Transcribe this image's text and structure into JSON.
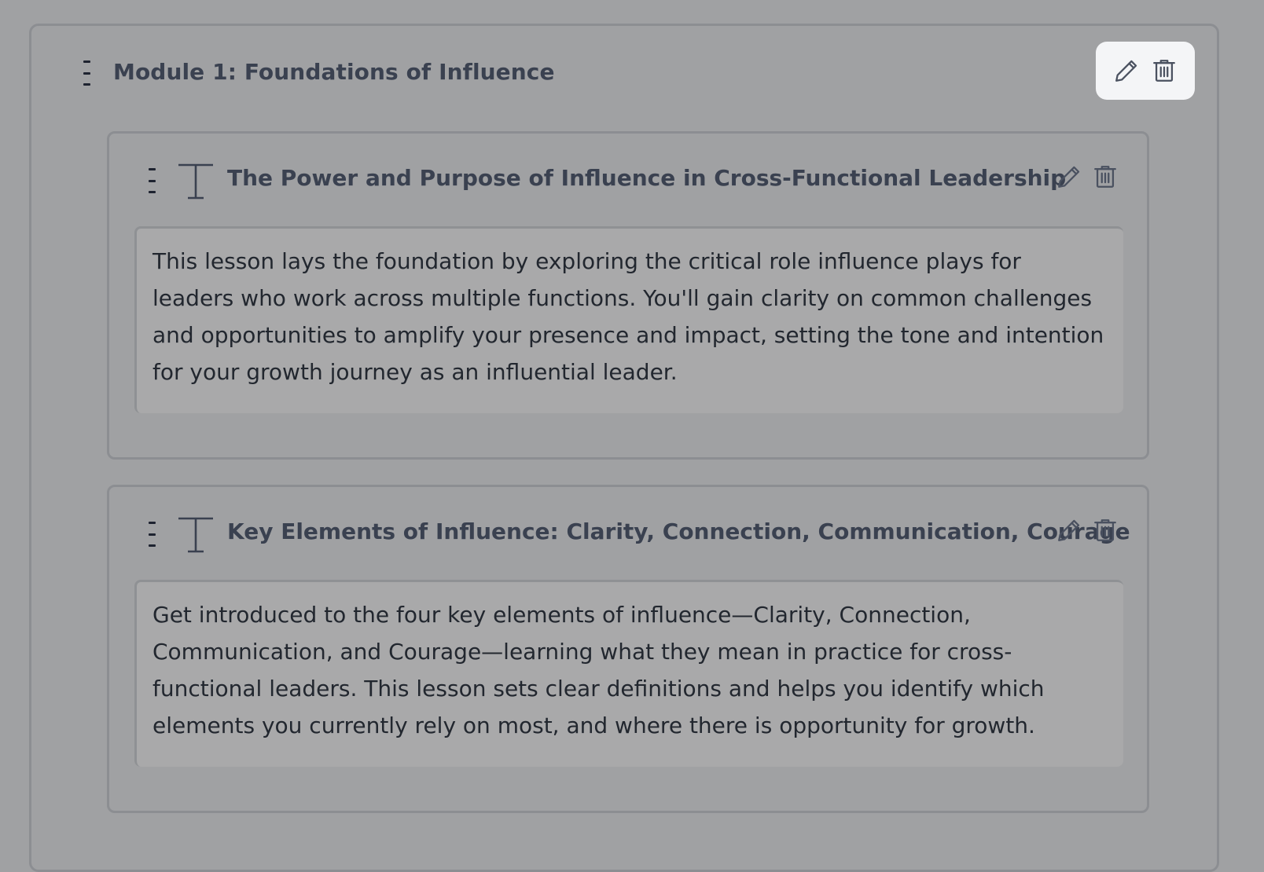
{
  "module": {
    "title": "Module 1: Foundations of Influence",
    "actions": {
      "edit_icon": "pencil-icon",
      "delete_icon": "trash-icon"
    }
  },
  "lessons": [
    {
      "type_icon": "text-type-icon",
      "title": "The Power and Purpose of Influence in Cross-Functional Leadership",
      "description": "This lesson lays the foundation by exploring the critical role influence plays for leaders who work across multiple functions. You'll gain clarity on common challenges and opportunities to amplify your presence and impact, setting the tone and intention for your growth journey as an influential leader."
    },
    {
      "type_icon": "text-type-icon",
      "title": "Key Elements of Influence: Clarity, Connection, Communication, Courage",
      "description": "Get introduced to the four key elements of influence—Clarity, Connection, Communication, and Courage—learning what they mean in practice for cross-functional leaders. This lesson sets clear definitions and helps you identify which elements you currently rely on most, and where there is opportunity for growth."
    }
  ],
  "colors": {
    "background": "#a0a1a3",
    "border": "#8c8e92",
    "title_text": "#3a4150",
    "body_text": "#22272f",
    "action_panel": "#f4f5f7"
  }
}
